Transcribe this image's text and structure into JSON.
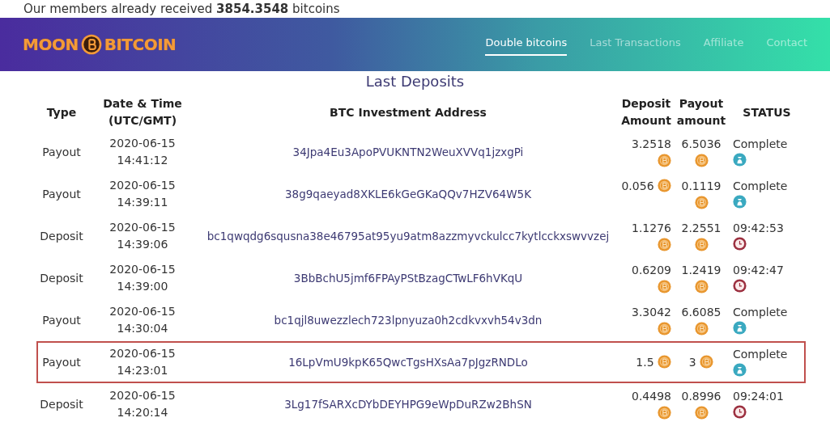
{
  "top_notice": {
    "text": "Our members already received **3854.3548** bitcoins"
  },
  "navbar": {
    "logo": [
      "MOON",
      "BITCOIN"
    ],
    "links": [
      {
        "label": "Double bitcoins",
        "selected": true
      },
      {
        "label": "Last Transactions",
        "selected": false
      },
      {
        "label": "Affiliate",
        "selected": false
      },
      {
        "label": "Contact",
        "selected": false
      }
    ]
  },
  "deposits": {
    "title": "Last Deposits",
    "columns": [
      "Type",
      "Date & Time (UTC/GMT)",
      "BTC Investment Address",
      "Deposit Amount",
      "Payout amount",
      "STATUS"
    ],
    "rows": [
      {
        "type": "Payout",
        "date": "2020-06-15",
        "time": "14:41:12",
        "address": "34Jpa4Eu3ApoPVUKNTN2WeuXVVq1jzxgPi",
        "deposit": "3.2518",
        "payout": "6.5036",
        "status": "Complete",
        "kind": "complete",
        "highlighted": false
      },
      {
        "type": "Payout",
        "date": "2020-06-15",
        "time": "14:39:11",
        "address": "38g9qaeyad8XKLE6kGeGKaQQv7HZV64W5K",
        "deposit": "0.056",
        "payout": "0.1119",
        "status": "Complete",
        "kind": "complete",
        "highlighted": false
      },
      {
        "type": "Deposit",
        "date": "2020-06-15",
        "time": "14:39:06",
        "address": "bc1qwqdg6squsna38e46795at95yu9atm8azzmyvckulcc7kytlcckxswvvzej",
        "deposit": "1.1276",
        "payout": "2.2551",
        "status": "09:42:53",
        "kind": "pending",
        "highlighted": false
      },
      {
        "type": "Deposit",
        "date": "2020-06-15",
        "time": "14:39:00",
        "address": "3BbBchU5jmf6FPAyPStBzagCTwLF6hVKqU",
        "deposit": "0.6209",
        "payout": "1.2419",
        "status": "09:42:47",
        "kind": "pending",
        "highlighted": false
      },
      {
        "type": "Payout",
        "date": "2020-06-15",
        "time": "14:30:04",
        "address": "bc1qjl8uwezzlech723lpnyuza0h2cdkvxvh54v3dn",
        "deposit": "3.3042",
        "payout": "6.6085",
        "status": "Complete",
        "kind": "complete",
        "highlighted": false
      },
      {
        "type": "Payout",
        "date": "2020-06-15",
        "time": "14:23:01",
        "address": "16LpVmU9kpK65QwcTgsHXsAa7pJgzRNDLo",
        "deposit": "1.5",
        "payout": "3",
        "status": "Complete",
        "kind": "complete",
        "highlighted": true
      },
      {
        "type": "Deposit",
        "date": "2020-06-15",
        "time": "14:20:14",
        "address": "3Lg17fSARXcDYbDEYHPG9eWpDuRZw2BhSN",
        "deposit": "0.4498",
        "payout": "0.8996",
        "status": "09:24:01",
        "kind": "pending",
        "highlighted": false
      }
    ]
  }
}
